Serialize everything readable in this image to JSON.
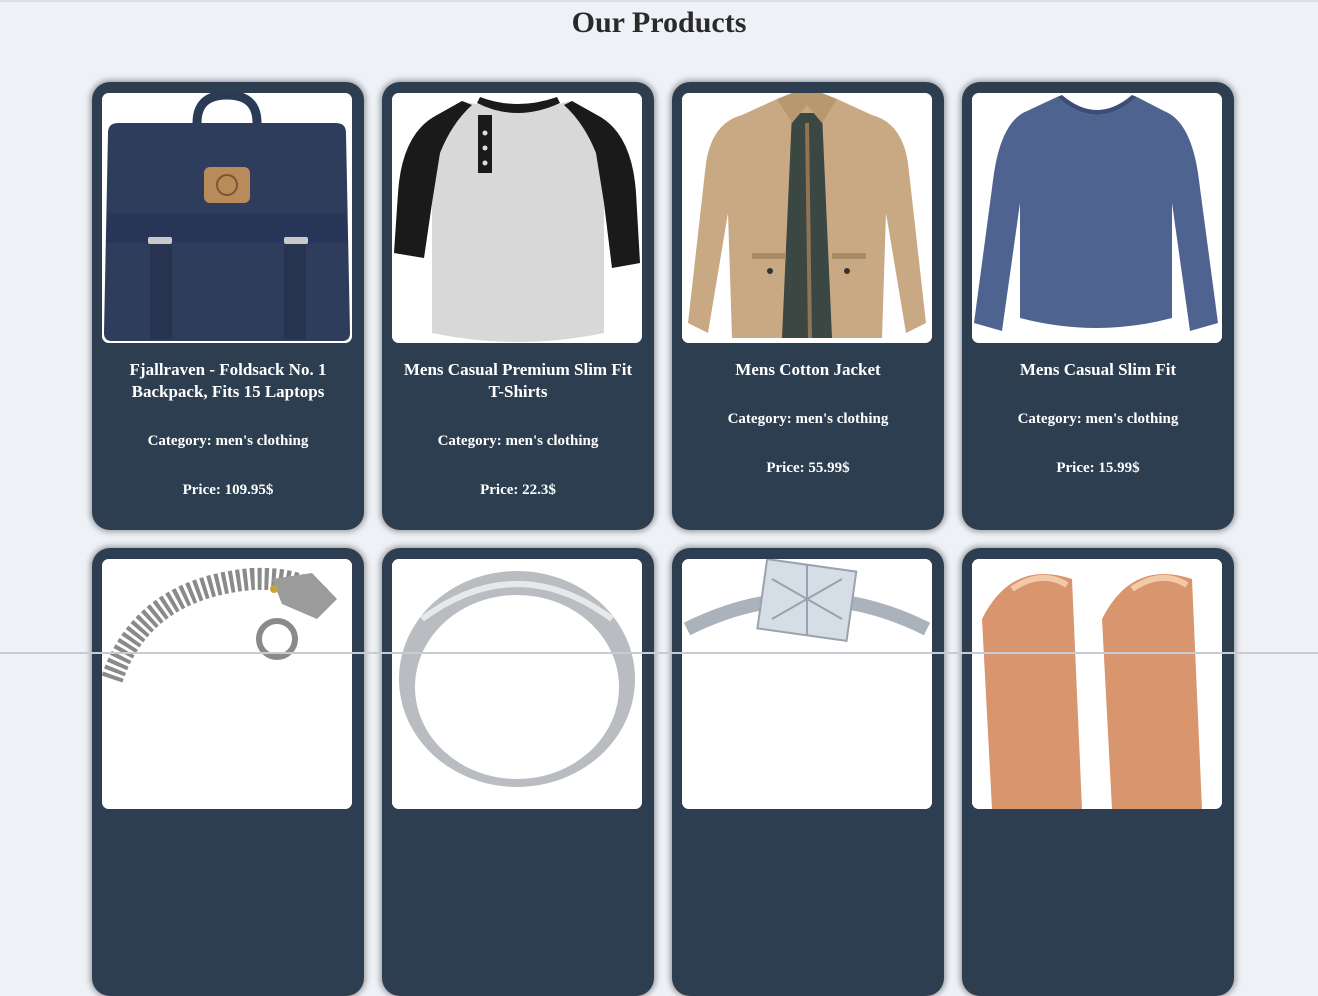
{
  "page": {
    "title": "Our Products"
  },
  "products": [
    {
      "title": "Fjallraven - Foldsack No. 1 Backpack, Fits 15 Laptops",
      "category": "Category: men's clothing",
      "price": "Price: 109.95$"
    },
    {
      "title": "Mens Casual Premium Slim Fit T-Shirts",
      "category": "Category: men's clothing",
      "price": "Price: 22.3$"
    },
    {
      "title": "Mens Cotton Jacket",
      "category": "Category: men's clothing",
      "price": "Price: 55.99$"
    },
    {
      "title": "Mens Casual Slim Fit",
      "category": "Category: men's clothing",
      "price": "Price: 15.99$"
    }
  ],
  "colors": {
    "background": "#eef1f6",
    "card": "#2c3e50",
    "card_text": "#ffffff",
    "title_text": "#2a2a2a"
  }
}
